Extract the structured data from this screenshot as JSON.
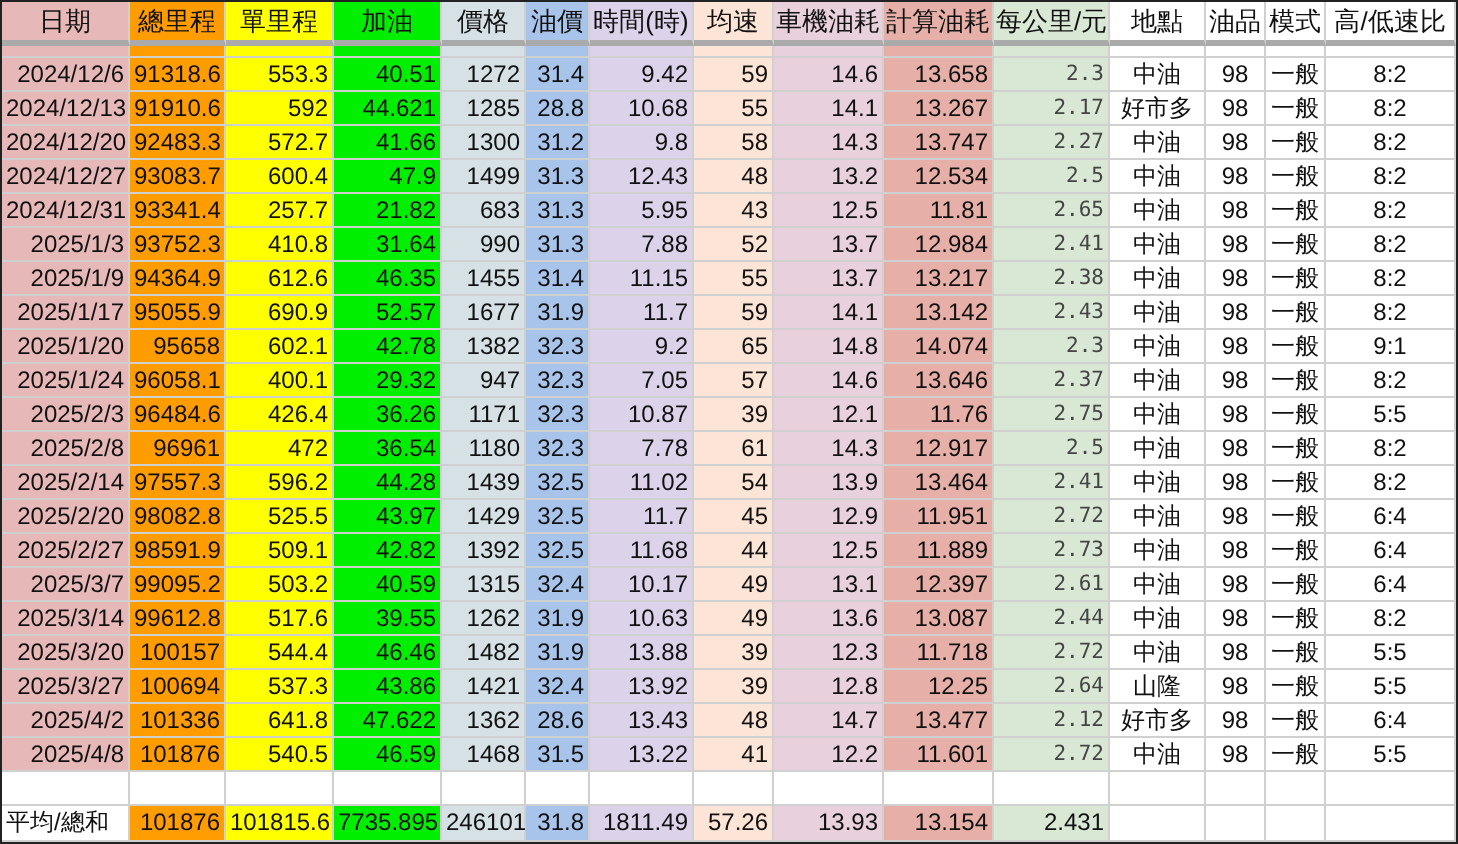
{
  "table": {
    "columns": [
      {
        "label": "日期"
      },
      {
        "label": "總里程"
      },
      {
        "label": "單里程"
      },
      {
        "label": "加油"
      },
      {
        "label": "價格"
      },
      {
        "label": "油價"
      },
      {
        "label": "時間(時)"
      },
      {
        "label": "均速"
      },
      {
        "label": "車機油耗"
      },
      {
        "label": "計算油耗"
      },
      {
        "label": "每公里/元"
      },
      {
        "label": "地點"
      },
      {
        "label": "油品"
      },
      {
        "label": "模式"
      },
      {
        "label": "高/低速比"
      }
    ],
    "rows": [
      [
        "2024/12/6",
        "91318.6",
        "553.3",
        "40.51",
        "1272",
        "31.4",
        "9.42",
        "59",
        "14.6",
        "13.658",
        "2.3",
        "中油",
        "98",
        "一般",
        "8:2"
      ],
      [
        "2024/12/13",
        "91910.6",
        "592",
        "44.621",
        "1285",
        "28.8",
        "10.68",
        "55",
        "14.1",
        "13.267",
        "2.17",
        "好市多",
        "98",
        "一般",
        "8:2"
      ],
      [
        "2024/12/20",
        "92483.3",
        "572.7",
        "41.66",
        "1300",
        "31.2",
        "9.8",
        "58",
        "14.3",
        "13.747",
        "2.27",
        "中油",
        "98",
        "一般",
        "8:2"
      ],
      [
        "2024/12/27",
        "93083.7",
        "600.4",
        "47.9",
        "1499",
        "31.3",
        "12.43",
        "48",
        "13.2",
        "12.534",
        "2.5",
        "中油",
        "98",
        "一般",
        "8:2"
      ],
      [
        "2024/12/31",
        "93341.4",
        "257.7",
        "21.82",
        "683",
        "31.3",
        "5.95",
        "43",
        "12.5",
        "11.81",
        "2.65",
        "中油",
        "98",
        "一般",
        "8:2"
      ],
      [
        "2025/1/3",
        "93752.3",
        "410.8",
        "31.64",
        "990",
        "31.3",
        "7.88",
        "52",
        "13.7",
        "12.984",
        "2.41",
        "中油",
        "98",
        "一般",
        "8:2"
      ],
      [
        "2025/1/9",
        "94364.9",
        "612.6",
        "46.35",
        "1455",
        "31.4",
        "11.15",
        "55",
        "13.7",
        "13.217",
        "2.38",
        "中油",
        "98",
        "一般",
        "8:2"
      ],
      [
        "2025/1/17",
        "95055.9",
        "690.9",
        "52.57",
        "1677",
        "31.9",
        "11.7",
        "59",
        "14.1",
        "13.142",
        "2.43",
        "中油",
        "98",
        "一般",
        "8:2"
      ],
      [
        "2025/1/20",
        "95658",
        "602.1",
        "42.78",
        "1382",
        "32.3",
        "9.2",
        "65",
        "14.8",
        "14.074",
        "2.3",
        "中油",
        "98",
        "一般",
        "9:1"
      ],
      [
        "2025/1/24",
        "96058.1",
        "400.1",
        "29.32",
        "947",
        "32.3",
        "7.05",
        "57",
        "14.6",
        "13.646",
        "2.37",
        "中油",
        "98",
        "一般",
        "8:2"
      ],
      [
        "2025/2/3",
        "96484.6",
        "426.4",
        "36.26",
        "1171",
        "32.3",
        "10.87",
        "39",
        "12.1",
        "11.76",
        "2.75",
        "中油",
        "98",
        "一般",
        "5:5"
      ],
      [
        "2025/2/8",
        "96961",
        "472",
        "36.54",
        "1180",
        "32.3",
        "7.78",
        "61",
        "14.3",
        "12.917",
        "2.5",
        "中油",
        "98",
        "一般",
        "8:2"
      ],
      [
        "2025/2/14",
        "97557.3",
        "596.2",
        "44.28",
        "1439",
        "32.5",
        "11.02",
        "54",
        "13.9",
        "13.464",
        "2.41",
        "中油",
        "98",
        "一般",
        "8:2"
      ],
      [
        "2025/2/20",
        "98082.8",
        "525.5",
        "43.97",
        "1429",
        "32.5",
        "11.7",
        "45",
        "12.9",
        "11.951",
        "2.72",
        "中油",
        "98",
        "一般",
        "6:4"
      ],
      [
        "2025/2/27",
        "98591.9",
        "509.1",
        "42.82",
        "1392",
        "32.5",
        "11.68",
        "44",
        "12.5",
        "11.889",
        "2.73",
        "中油",
        "98",
        "一般",
        "6:4"
      ],
      [
        "2025/3/7",
        "99095.2",
        "503.2",
        "40.59",
        "1315",
        "32.4",
        "10.17",
        "49",
        "13.1",
        "12.397",
        "2.61",
        "中油",
        "98",
        "一般",
        "6:4"
      ],
      [
        "2025/3/14",
        "99612.8",
        "517.6",
        "39.55",
        "1262",
        "31.9",
        "10.63",
        "49",
        "13.6",
        "13.087",
        "2.44",
        "中油",
        "98",
        "一般",
        "8:2"
      ],
      [
        "2025/3/20",
        "100157",
        "544.4",
        "46.46",
        "1482",
        "31.9",
        "13.88",
        "39",
        "12.3",
        "11.718",
        "2.72",
        "中油",
        "98",
        "一般",
        "5:5"
      ],
      [
        "2025/3/27",
        "100694",
        "537.3",
        "43.86",
        "1421",
        "32.4",
        "13.92",
        "39",
        "12.8",
        "12.25",
        "2.64",
        "山隆",
        "98",
        "一般",
        "5:5"
      ],
      [
        "2025/4/2",
        "101336",
        "641.8",
        "47.622",
        "1362",
        "28.6",
        "13.43",
        "48",
        "14.7",
        "13.477",
        "2.12",
        "好市多",
        "98",
        "一般",
        "6:4"
      ],
      [
        "2025/4/8",
        "101876",
        "540.5",
        "46.59",
        "1468",
        "31.5",
        "13.22",
        "41",
        "12.2",
        "11.601",
        "2.72",
        "中油",
        "98",
        "一般",
        "5:5"
      ]
    ],
    "summary": {
      "label": "平均/總和",
      "values": [
        "101876",
        "101815.6",
        "7735.895",
        "246101",
        "31.8",
        "1811.49",
        "57.26",
        "13.93",
        "13.154",
        "2.431"
      ]
    }
  }
}
